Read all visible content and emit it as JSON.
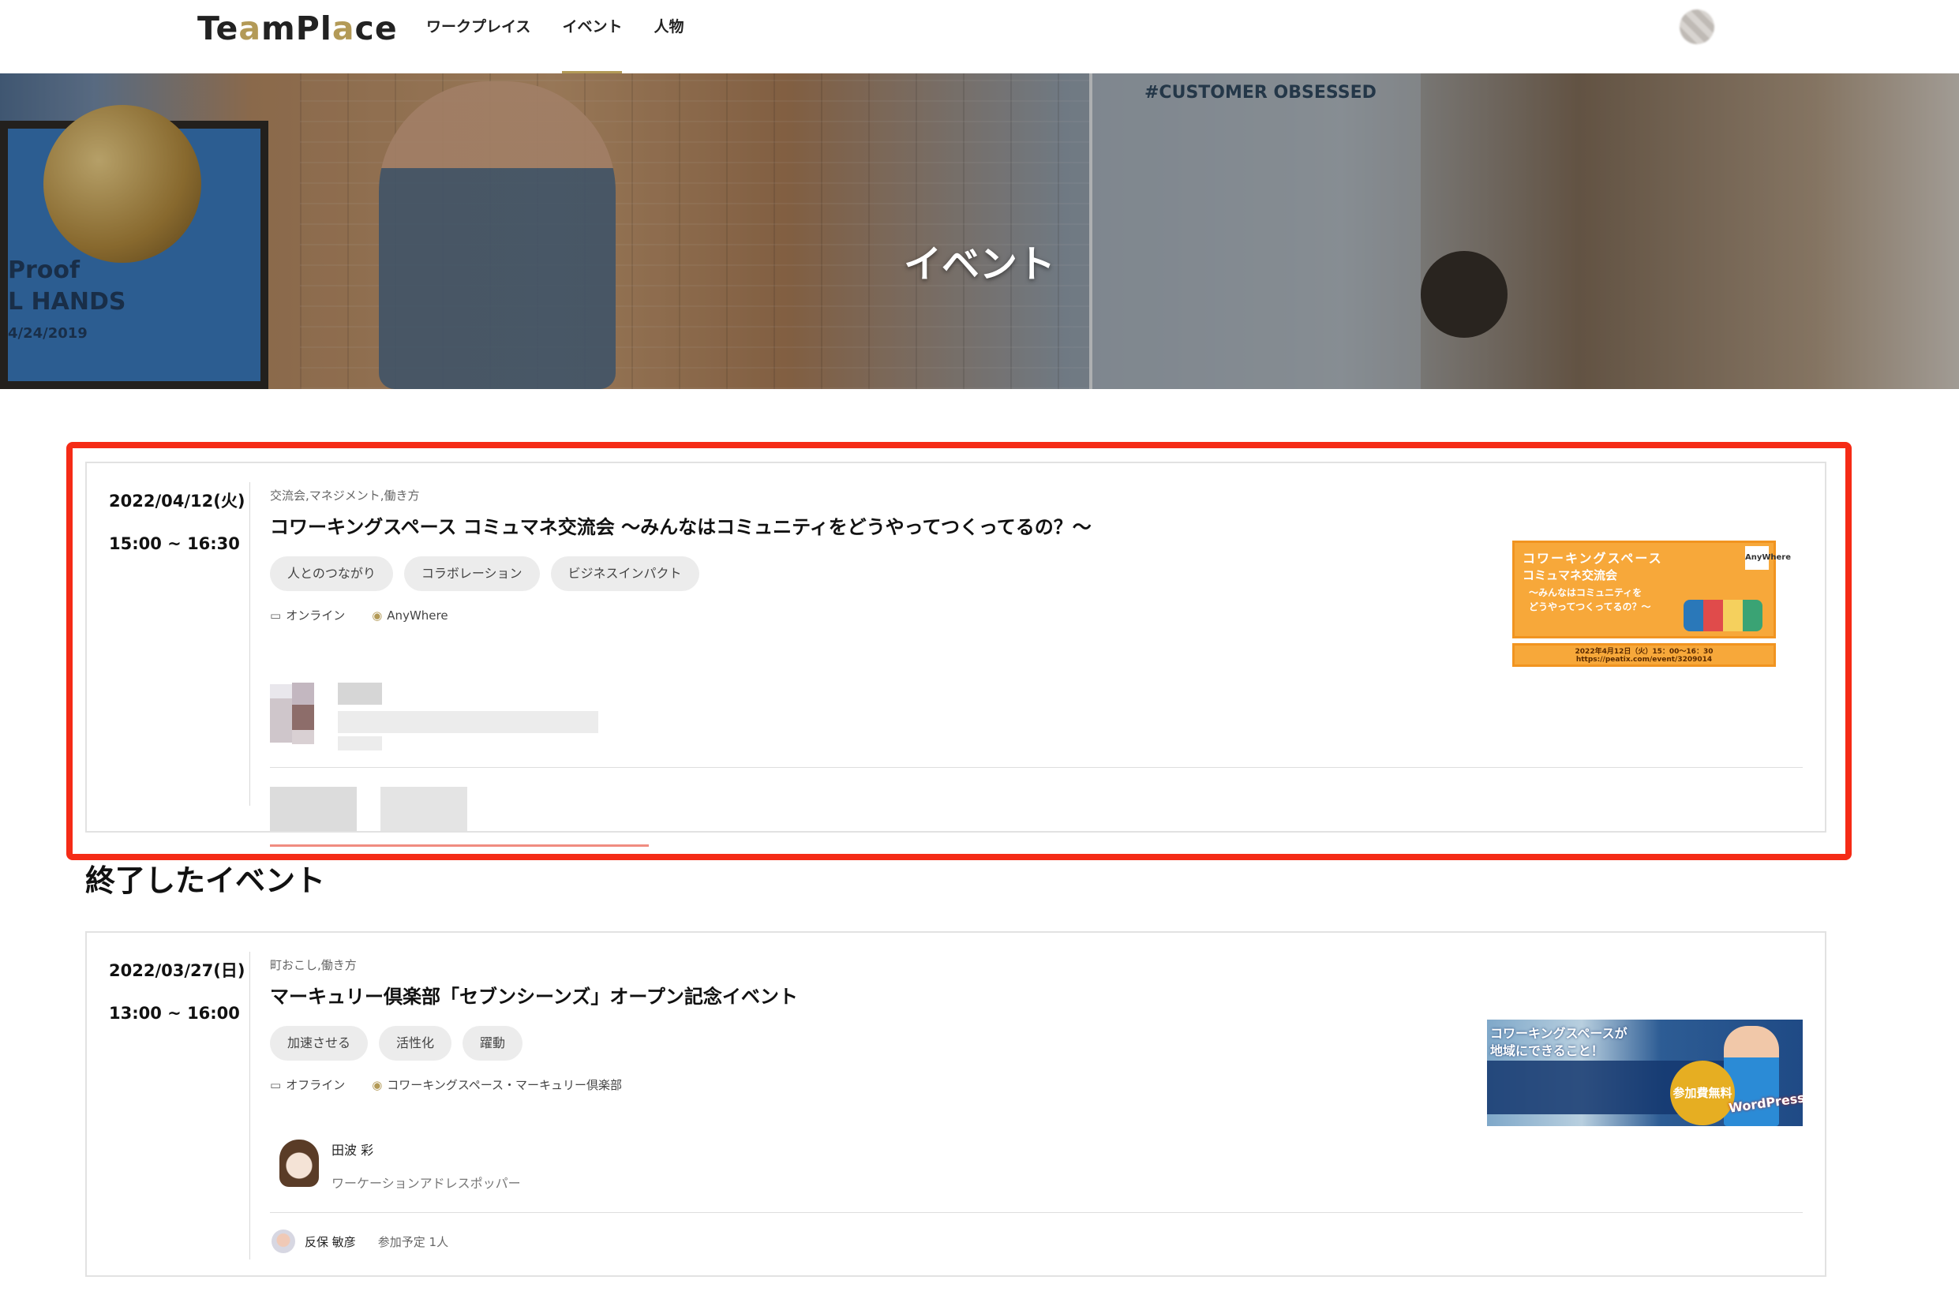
{
  "header": {
    "logo_prefix": "Te",
    "logo_accent": "a",
    "logo_suffix": "mPl",
    "logo_accent2": "a",
    "logo_end": "ce",
    "nav": [
      {
        "label": "ワークプレイス"
      },
      {
        "label": "イベント"
      },
      {
        "label": "人物"
      }
    ],
    "active_nav": "イベント"
  },
  "hero": {
    "title": "イベント",
    "screen_text_1": "Proof",
    "screen_text_2": "L HANDS",
    "screen_text_3": "4/24/2019",
    "board_text": "#CUSTOMER OBSESSED"
  },
  "upcoming_event": {
    "date": "2022/04/12(火)",
    "time": "15:00 ~ 16:30",
    "categories": "交流会,マネジメント,働き方",
    "title": "コワーキングスペース コミュマネ交流会 〜みんなはコミュニティをどうやってつくってるの？〜",
    "tags": [
      "人とのつながり",
      "コラボレーション",
      "ビジネスインパクト"
    ],
    "format": "オンライン",
    "venue": "AnyWhere",
    "thumbnail": {
      "line1": "コワーキングスペース",
      "line2": "コミュマネ交流会",
      "line3": "〜みんなはコミュニティを",
      "line4": "どうやってつくってるの？〜",
      "brand": "AnyWhere",
      "footer": "2022年4月12日（火）15：00〜16：30 https://peatix.com/event/3209014"
    }
  },
  "section_title": "終了したイベント",
  "past_event": {
    "date": "2022/03/27(日)",
    "time": "13:00 ~ 16:00",
    "categories": "町おこし,働き方",
    "title": "マーキュリー倶楽部「セブンシーンズ」オープン記念イベント",
    "tags": [
      "加速させる",
      "活性化",
      "躍動"
    ],
    "format": "オフライン",
    "venue": "コワーキングスペース・マーキュリー倶楽部",
    "host_name": "田波 彩",
    "host_role": "ワーケーションアドレスポッパー",
    "attendee_name": "反保 敏彦",
    "attendee_count": "参加予定 1人",
    "thumbnail": {
      "line1": "コワーキングスペースが",
      "line2": "地域にできること！",
      "badge": "参加費無料",
      "product": "WordPress"
    }
  },
  "colors": {
    "accent": "#b39a57",
    "highlight": "#f52b16",
    "tag_bg": "#ececec"
  }
}
